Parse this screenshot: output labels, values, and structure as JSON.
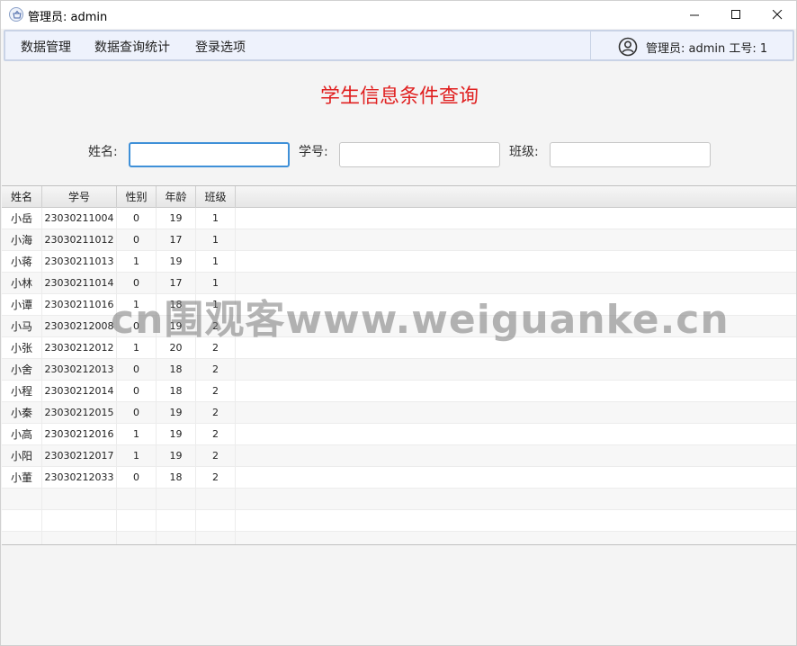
{
  "window": {
    "title": "管理员:  admin",
    "controls": [
      "minimize-icon",
      "maximize-icon",
      "close-icon"
    ]
  },
  "menu": {
    "items": [
      {
        "label": "数据管理"
      },
      {
        "label": "数据查询统计"
      },
      {
        "label": "登录选项"
      }
    ],
    "user_label": "管理员: admin 工号: 1"
  },
  "page": {
    "title": "学生信息条件查询",
    "title_color": "#e02020"
  },
  "search": {
    "name_label": "姓名:",
    "name_value": "",
    "id_label": "学号:",
    "id_value": "",
    "class_label": "班级:",
    "class_value": ""
  },
  "table": {
    "columns": [
      "姓名",
      "学号",
      "性别",
      "年龄",
      "班级"
    ],
    "rows": [
      [
        "小岳",
        "23030211004",
        "0",
        "19",
        "1"
      ],
      [
        "小海",
        "23030211012",
        "0",
        "17",
        "1"
      ],
      [
        "小蒋",
        "23030211013",
        "1",
        "19",
        "1"
      ],
      [
        "小林",
        "23030211014",
        "0",
        "17",
        "1"
      ],
      [
        "小谭",
        "23030211016",
        "1",
        "18",
        "1"
      ],
      [
        "小马",
        "23030212008",
        "0",
        "19",
        "2"
      ],
      [
        "小张",
        "23030212012",
        "1",
        "20",
        "2"
      ],
      [
        "小舍",
        "23030212013",
        "0",
        "18",
        "2"
      ],
      [
        "小程",
        "23030212014",
        "0",
        "18",
        "2"
      ],
      [
        "小秦",
        "23030212015",
        "0",
        "19",
        "2"
      ],
      [
        "小高",
        "23030212016",
        "1",
        "19",
        "2"
      ],
      [
        "小阳",
        "23030212017",
        "1",
        "19",
        "2"
      ],
      [
        "小董",
        "23030212033",
        "0",
        "18",
        "2"
      ]
    ],
    "empty_rows": 3
  },
  "watermark": "cn围观客www.weiguanke.cn"
}
